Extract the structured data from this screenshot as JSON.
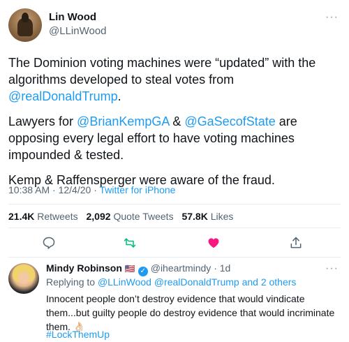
{
  "tweet": {
    "author_name": "Lin Wood",
    "author_handle": "@LLinWood",
    "more_label": "···",
    "paragraphs": [
      {
        "segments": [
          {
            "text": "The Dominion voting machines were “updated” with the algorithms developed to steal votes from ",
            "type": "text"
          },
          {
            "text": "@realDonaldTrump",
            "type": "mention"
          },
          {
            "text": ".",
            "type": "text"
          }
        ]
      },
      {
        "segments": [
          {
            "text": "Lawyers for ",
            "type": "text"
          },
          {
            "text": "@BrianKempGA",
            "type": "mention"
          },
          {
            "text": " & ",
            "type": "text"
          },
          {
            "text": "@GaSecofState",
            "type": "mention"
          },
          {
            "text": " are opposing every legal effort to have voting machines impounded & tested.",
            "type": "text"
          }
        ]
      },
      {
        "segments": [
          {
            "text": "Kemp & Raffensperger were aware of the fraud.",
            "type": "text"
          }
        ]
      }
    ],
    "time": "10:38 AM · 12/4/20 · ",
    "source": "Twitter for iPhone",
    "stats": {
      "retweets_count": "21.4K",
      "retweets_label": "Retweets",
      "quotes_count": "2,092",
      "quotes_label": "Quote Tweets",
      "likes_count": "57.8K",
      "likes_label": "Likes"
    }
  },
  "icons": {
    "reply": "comment-icon",
    "retweet": "retweet-icon",
    "like": "heart-icon",
    "share": "share-icon"
  },
  "colors": {
    "accent": "#1d9bf0",
    "retweet": "#00ba7c",
    "like": "#f91880",
    "muted": "#536471"
  },
  "reply": {
    "author_name": "Mindy Robinson",
    "flag": "🇺🇸",
    "author_handle": "@iheartmindy",
    "age": " · 1d",
    "replying_prefix": "Replying to ",
    "replying_mentions": "@LLinWood @realDonaldTrump and 2 others",
    "text": "Innocent people don’t destroy evidence that would vindicate them...but guilty people do destroy evidence that would incriminate them. 👌🏻",
    "hashtag": "#LockThemUp",
    "more_label": "···"
  }
}
